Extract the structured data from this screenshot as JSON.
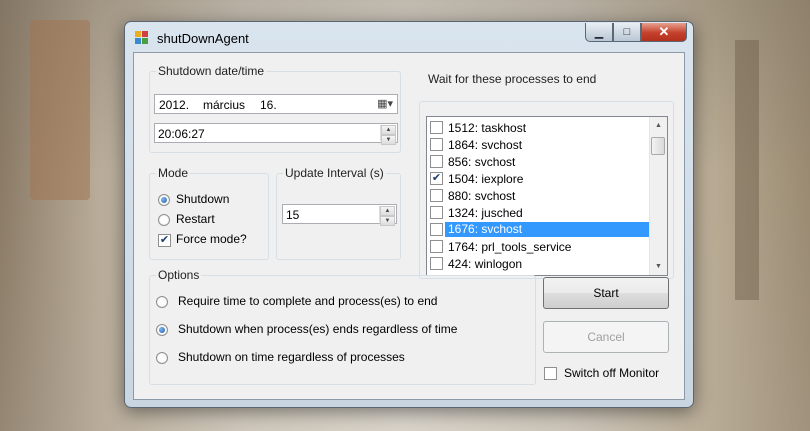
{
  "window": {
    "title": "shutDownAgent"
  },
  "shutdown_datetime": {
    "label": "Shutdown date/time",
    "date": {
      "year": "2012.",
      "month": "március",
      "day": "16."
    },
    "time": "20:06:27"
  },
  "mode": {
    "label": "Mode",
    "options": [
      {
        "label": "Shutdown",
        "selected": true
      },
      {
        "label": "Restart",
        "selected": false
      }
    ],
    "force_mode": {
      "label": "Force mode?",
      "checked": true
    }
  },
  "update_interval": {
    "label": "Update Interval (s)",
    "value": "15"
  },
  "processes": {
    "label": "Wait for these processes to end",
    "items": [
      {
        "label": "1512: taskhost",
        "checked": false
      },
      {
        "label": "1864: svchost",
        "checked": false
      },
      {
        "label": "856: svchost",
        "checked": false
      },
      {
        "label": "1504: iexplore",
        "checked": true
      },
      {
        "label": "880: svchost",
        "checked": false
      },
      {
        "label": "1324: jusched",
        "checked": false
      },
      {
        "label": "1676: svchost",
        "checked": false,
        "selected": true
      },
      {
        "label": "1764: prl_tools_service",
        "checked": false
      },
      {
        "label": "424: winlogon",
        "checked": false
      }
    ]
  },
  "options": {
    "label": "Options",
    "items": [
      {
        "label": "Require time to complete and process(es) to end",
        "selected": false
      },
      {
        "label": "Shutdown when process(es) ends regardless of time",
        "selected": true
      },
      {
        "label": "Shutdown on time regardless of processes",
        "selected": false
      }
    ]
  },
  "buttons": {
    "start": "Start",
    "cancel": "Cancel"
  },
  "switch_off_monitor": {
    "label": "Switch off Monitor",
    "checked": false
  },
  "colors": {
    "selection": "#3399ff",
    "close_button": "#c4402b"
  }
}
